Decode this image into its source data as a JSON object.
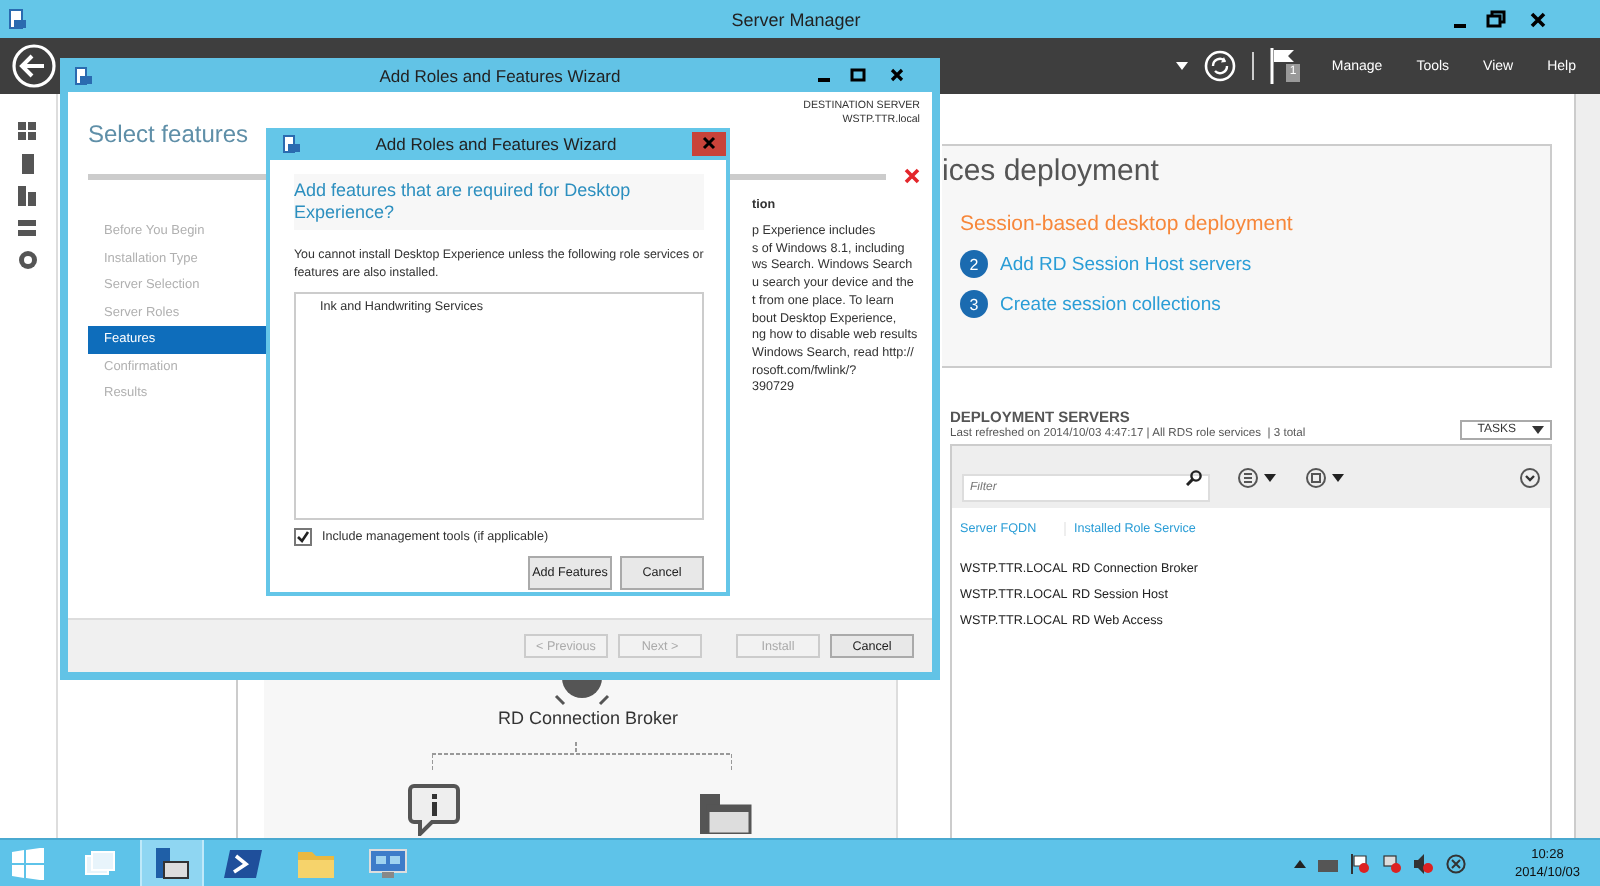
{
  "window": {
    "title": "Server Manager"
  },
  "toolbar": {
    "flag_badge": "1",
    "menus": [
      "Manage",
      "Tools",
      "View",
      "Help"
    ]
  },
  "wizard": {
    "title": "Add Roles and Features Wizard",
    "heading": "Select features",
    "destination_label": "DESTINATION SERVER",
    "destination_server": "WSTP.TTR.local",
    "steps": [
      {
        "label": "Before You Begin",
        "selected": false
      },
      {
        "label": "Installation Type",
        "selected": false
      },
      {
        "label": "Server Selection",
        "selected": false
      },
      {
        "label": "Server Roles",
        "selected": false
      },
      {
        "label": "Features",
        "selected": true
      },
      {
        "label": "Confirmation",
        "selected": false
      },
      {
        "label": "Results",
        "selected": false
      }
    ],
    "description_heading": "tion",
    "description": "p Experience includes\ns of Windows 8.1, including\nws Search. Windows Search\nu search your device and the\nt from one place. To learn\nbout Desktop Experience,\nng how to disable web results\nWindows Search, read http://\nrosoft.com/fwlink/?\n390729",
    "buttons": [
      {
        "label": "< Previous",
        "disabled": true
      },
      {
        "label": "Next >",
        "disabled": true
      },
      {
        "label": "Install",
        "disabled": true
      },
      {
        "label": "Cancel",
        "disabled": false
      }
    ]
  },
  "dialog": {
    "title": "Add Roles and Features Wizard",
    "heading": "Add features that are required for Desktop Experience?",
    "message": "You cannot install Desktop Experience unless the following role services or features are also installed.",
    "features": [
      {
        "label": "Ink and Handwriting Services"
      }
    ],
    "include_tools": {
      "label": "Include management tools (if applicable)",
      "checked": true
    },
    "buttons": [
      "Add Features",
      "Cancel"
    ]
  },
  "deployment": {
    "title": "ices deployment",
    "subtitle": "Session-based desktop deployment",
    "steps": [
      {
        "number": "2",
        "label": "Add RD Session Host servers"
      },
      {
        "number": "3",
        "label": "Create session collections"
      }
    ]
  },
  "servers": {
    "title": "DEPLOYMENT SERVERS",
    "refreshed": "Last refreshed on 2014/10/03 4:47:17 | All RDS role services  | 3 total",
    "tasks": "TASKS",
    "filter_placeholder": "Filter",
    "columns": [
      "Server FQDN",
      "Installed Role Service"
    ],
    "rows": [
      [
        "WSTP.TTR.LOCAL",
        "RD Connection Broker"
      ],
      [
        "WSTP.TTR.LOCAL",
        "RD Session Host"
      ],
      [
        "WSTP.TTR.LOCAL",
        "RD Web Access"
      ]
    ]
  },
  "diagram": {
    "node_label": "RD Connection Broker"
  },
  "taskbar": {
    "apps": [
      {
        "kind": "window",
        "selected": false
      },
      {
        "kind": "server-manager",
        "selected": true
      },
      {
        "kind": "powershell",
        "selected": false
      },
      {
        "kind": "folder",
        "selected": false
      },
      {
        "kind": "remote",
        "selected": false
      }
    ],
    "time": "10:28",
    "date": "2014/10/03"
  }
}
